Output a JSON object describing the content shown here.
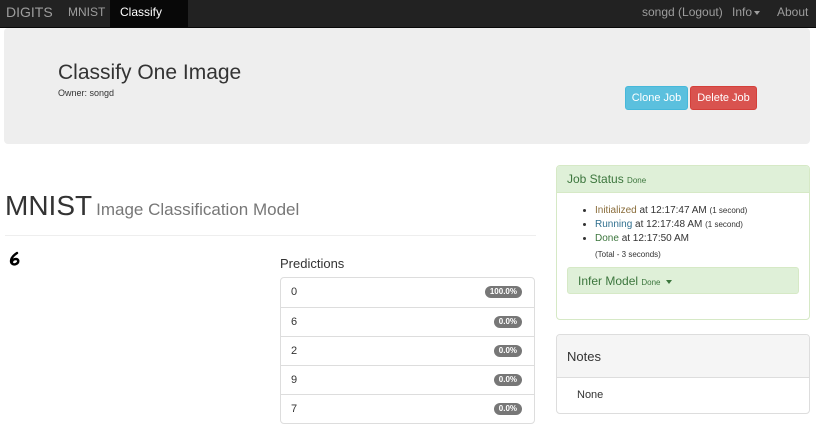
{
  "navbar": {
    "brand": "DIGITS",
    "items": [
      "MNIST",
      "Classify One"
    ],
    "user": "songd (Logout)",
    "info": "Info",
    "about": "About"
  },
  "header": {
    "title": "Classify One Image",
    "owner": "Owner: songd",
    "clone_label": "Clone Job",
    "delete_label": "Delete Job"
  },
  "model": {
    "name": "MNIST",
    "subtitle": "Image Classification Model"
  },
  "predictions": {
    "title": "Predictions",
    "rows": [
      {
        "label": "0",
        "value": "100.0%"
      },
      {
        "label": "6",
        "value": "0.0%"
      },
      {
        "label": "2",
        "value": "0.0%"
      },
      {
        "label": "9",
        "value": "0.0%"
      },
      {
        "label": "7",
        "value": "0.0%"
      }
    ]
  },
  "job_status": {
    "title": "Job Status",
    "state": "Done",
    "events": [
      {
        "status": "Initialized",
        "time": "at 12:17:47 AM",
        "duration": "(1 second)"
      },
      {
        "status": "Running",
        "time": "at 12:17:48 AM",
        "duration": "(1 second)"
      },
      {
        "status": "Done",
        "time": "at 12:17:50 AM",
        "duration": ""
      }
    ],
    "total": "(Total - 3 seconds)",
    "infer_label": "Infer Model",
    "infer_state": "Done"
  },
  "notes": {
    "title": "Notes",
    "body": "None"
  },
  "colors": {
    "navbar_bg": "#222222",
    "clone_button": "#5bc0de",
    "delete_button": "#d9534f",
    "success_panel": "#dff0d8",
    "badge": "#777777"
  }
}
